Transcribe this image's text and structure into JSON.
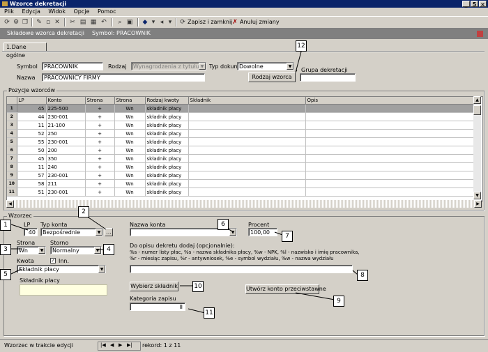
{
  "window": {
    "title": "Wzorce dekretacji",
    "controls": [
      "_",
      "5",
      "×"
    ]
  },
  "menu": [
    "Plik",
    "Edycja",
    "Widok",
    "Opcje",
    "Pomoc"
  ],
  "toolbar": {
    "save_and_close": "Zapisz i zamknij",
    "undo_changes": "Anuluj zmiany"
  },
  "caption": {
    "entity": "Składowe wzorca dekretacji",
    "symbol_label": "Symbol: PRACOWNIK"
  },
  "tab": "1.Dane ogólne",
  "header": {
    "symbol_label": "Symbol",
    "symbol_value": "PRACOWNIK",
    "type_label": "Rodzaj",
    "type_value": "Wynagrodzenia z tytułu umowy",
    "document_label": "Typ dokumentu",
    "document_value": "Dowolne",
    "name_label": "Nazwa",
    "name_value": "PRACOWNICY FIRMY",
    "group_label": "Grupa dekretacji",
    "group_value": "",
    "kind_button": "Rodzaj wzorca"
  },
  "rows_section": {
    "title": "Pozycje wzorców",
    "columns": [
      "LP",
      "Konto",
      "Strona",
      "Strona",
      "Rodzaj kwoty",
      "Składnik",
      "Opis"
    ],
    "rows": [
      {
        "ind": "1",
        "lp": "45",
        "konto": "225-500",
        "sign": "+",
        "side": "Wn",
        "kind": "składnik płacy"
      },
      {
        "ind": "2",
        "lp": "44",
        "konto": "230-001",
        "sign": "+",
        "side": "Wn",
        "kind": "składnik płacy"
      },
      {
        "ind": "3",
        "lp": "11",
        "konto": "21-100",
        "sign": "+",
        "side": "Wn",
        "kind": "składnik płacy"
      },
      {
        "ind": "4",
        "lp": "52",
        "konto": "250",
        "sign": "+",
        "side": "Wn",
        "kind": "składnik płacy"
      },
      {
        "ind": "5",
        "lp": "55",
        "konto": "230-001",
        "sign": "+",
        "side": "Wn",
        "kind": "składnik płacy"
      },
      {
        "ind": "6",
        "lp": "50",
        "konto": "200",
        "sign": "+",
        "side": "Wn",
        "kind": "składnik płacy"
      },
      {
        "ind": "7",
        "lp": "45",
        "konto": "350",
        "sign": "+",
        "side": "Wn",
        "kind": "składnik płacy"
      },
      {
        "ind": "8",
        "lp": "11",
        "konto": "240",
        "sign": "+",
        "side": "Wn",
        "kind": "składnik płacy"
      },
      {
        "ind": "9",
        "lp": "57",
        "konto": "230-001",
        "sign": "+",
        "side": "Wn",
        "kind": "składnik płacy"
      },
      {
        "ind": "10",
        "lp": "58",
        "konto": "211",
        "sign": "+",
        "side": "Wn",
        "kind": "składnik płacy"
      },
      {
        "ind": "11",
        "lp": "51",
        "konto": "230-001",
        "sign": "+",
        "side": "Wn",
        "kind": "składnik płacy"
      }
    ]
  },
  "editor": {
    "group_title": "Wzorzec",
    "lp_label": "LP",
    "lp_value": "40",
    "account_type_label": "Typ konta",
    "account_type_value": "Bezpośrednie",
    "account_name_label": "Nazwa konta",
    "account_name_value": "",
    "percent_label": "Procent",
    "percent_value": "100,00",
    "side_label": "Strona",
    "side_value": "Wn",
    "sign_label": "Storno",
    "sign_value": "Normalny",
    "kind_label": "Kwota",
    "kind_checkbox_label": "Inn.",
    "kind_value": "Składnik płacy",
    "component_label": "Składnik płacy",
    "help_title": "Do opisu dekretu dodaj (opcjonalnie):",
    "help_line1": "%s - numer listy płac, %s - nazwa składnika płacy, %w - NPK, %l - nazwisko i imię pracownika,",
    "help_line2": "%r - miesiąc zapisu, %r - antywniosek, %e - symbol wydziału, %w - nazwa wydziału",
    "description_value": "",
    "pick_component_button": "Wybierz składnik",
    "create_account_button": "Utwórz konto przeciwstawne",
    "sequence_label": "Kategoria zapisu",
    "sequence_value": "II"
  },
  "callouts": [
    "1",
    "2",
    "3",
    "4",
    "5",
    "6",
    "7",
    "8",
    "9",
    "10",
    "11",
    "12"
  ],
  "status": {
    "left": "Wzorzec w trakcie edycji",
    "record": "rekord: 1 z 11"
  }
}
